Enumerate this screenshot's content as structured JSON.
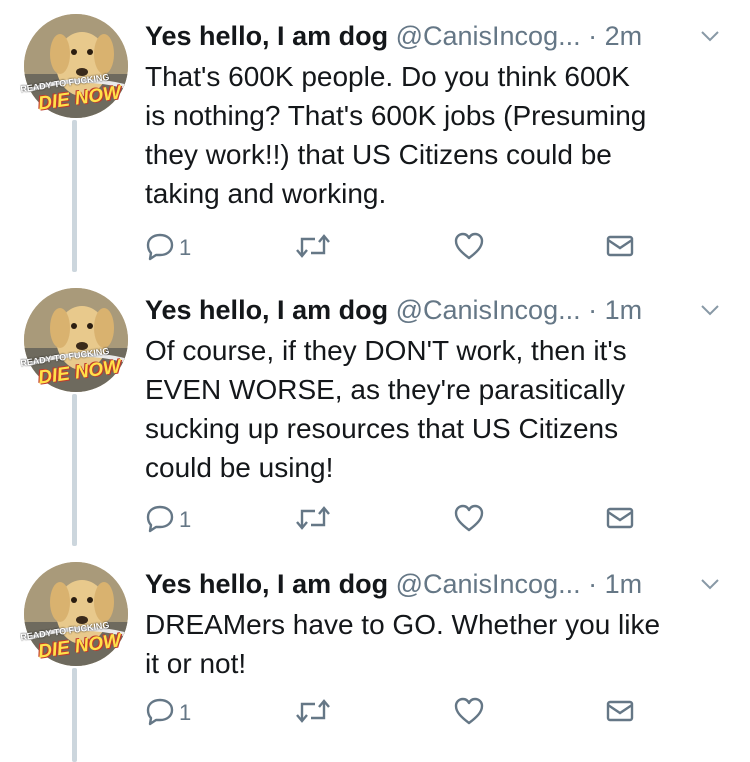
{
  "thread": {
    "tweets": [
      {
        "display_name": "Yes hello, I am dog",
        "handle": "@CanisIncog...",
        "time": "· 2m",
        "text_lines": [
          "That's 600K people. Do you think 600K",
          "is nothing? That's 600K jobs (Presuming",
          "they work!!) that US Citizens could be",
          "taking and working."
        ],
        "reply_count": "1",
        "avatar": {
          "caption_top": "READY TO FUCKING",
          "caption_bottom": "DIE NOW"
        }
      },
      {
        "display_name": "Yes hello, I am dog",
        "handle": "@CanisIncog...",
        "time": "· 1m",
        "text_lines": [
          "Of course, if they DON'T work, then it's",
          "EVEN WORSE, as they're parasitically",
          "sucking up resources that US Citizens",
          "could be using!"
        ],
        "reply_count": "1",
        "avatar": {
          "caption_top": "READY TO FUCKING",
          "caption_bottom": "DIE NOW"
        }
      },
      {
        "display_name": "Yes hello, I am dog",
        "handle": "@CanisIncog...",
        "time": "· 1m",
        "text_lines": [
          "DREAMers have to GO. Whether you like",
          "it or not!"
        ],
        "reply_count": "1",
        "avatar": {
          "caption_top": "READY TO FUCKING",
          "caption_bottom": "DIE NOW"
        }
      }
    ]
  },
  "colors": {
    "name": "#14171a",
    "meta": "#657786",
    "thread_line": "#ccd6dd"
  },
  "icons": [
    "reply-icon",
    "retweet-icon",
    "like-icon",
    "direct-message-icon",
    "chevron-down-icon"
  ]
}
